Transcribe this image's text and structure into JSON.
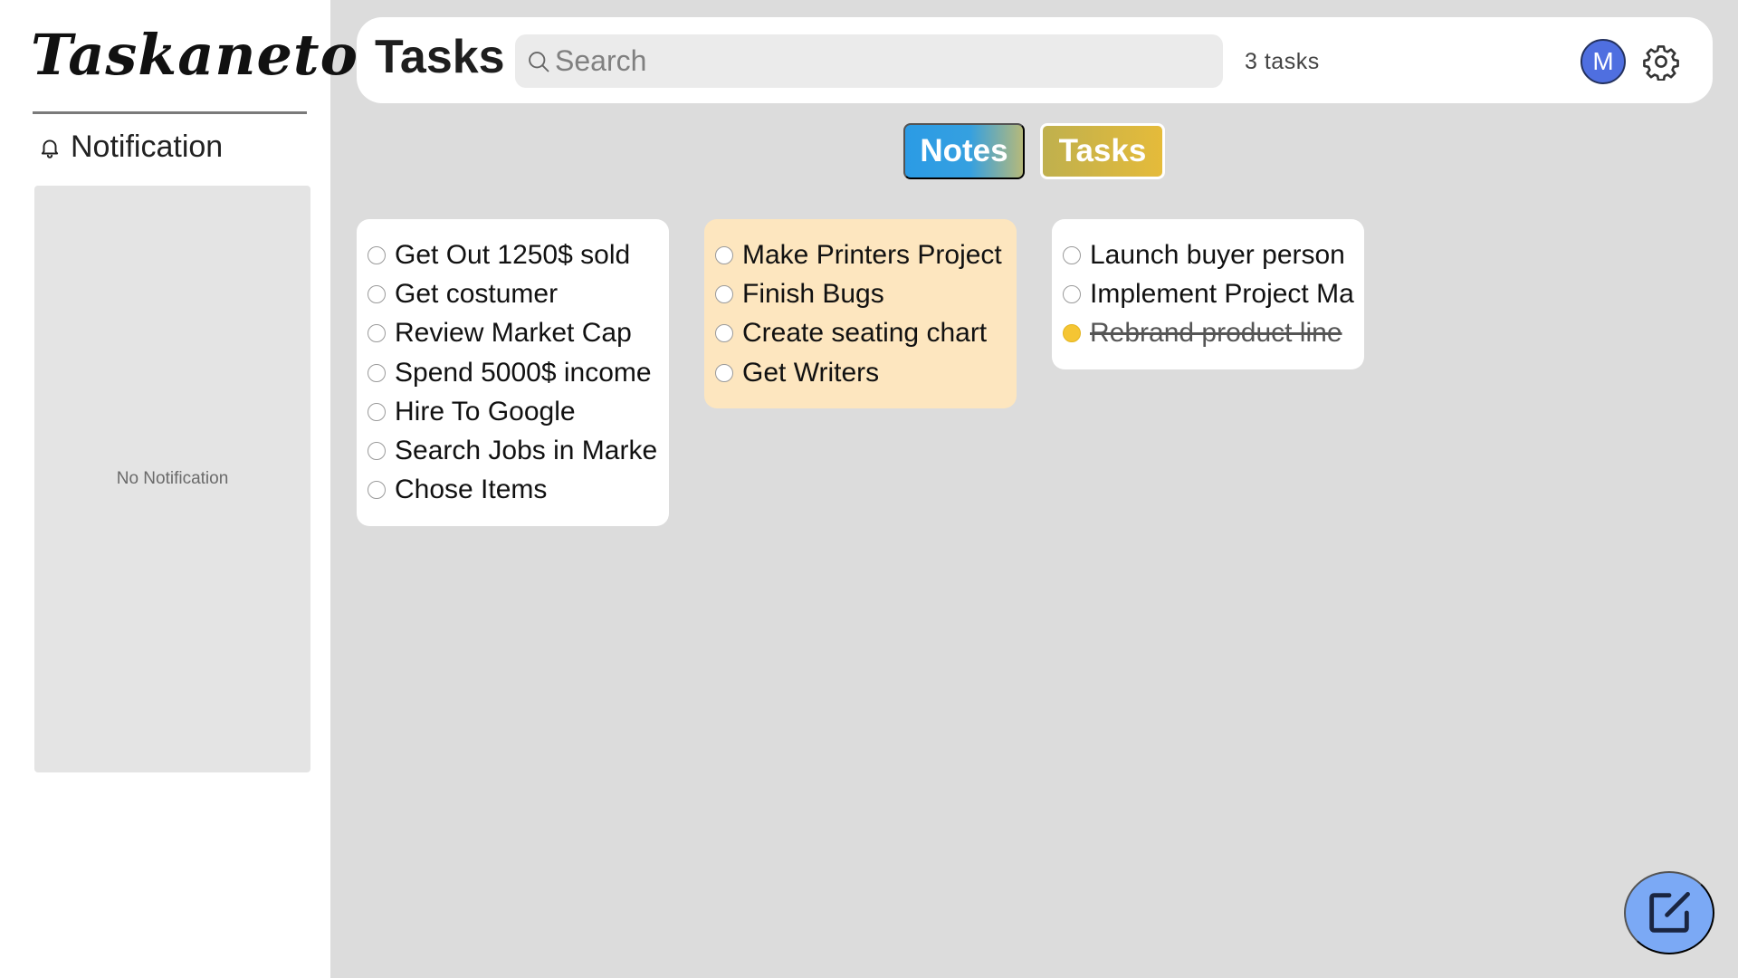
{
  "sidebar": {
    "logo": "Taskaneto",
    "notification_title": "Notification",
    "empty_text": "No Notification"
  },
  "header": {
    "title": "Tasks",
    "search_placeholder": "Search",
    "search_value": "",
    "task_count": "3 tasks",
    "avatar_initial": "M"
  },
  "toggle": {
    "notes_label": "Notes",
    "tasks_label": "Tasks",
    "active": "Tasks"
  },
  "cards": [
    {
      "color": "#ffffff",
      "tasks": [
        {
          "text": "Get Out 1250$ sold",
          "done": false
        },
        {
          "text": "Get costumer",
          "done": false
        },
        {
          "text": "Review Market Cap",
          "done": false
        },
        {
          "text": "Spend 5000$ income",
          "done": false
        },
        {
          "text": "Hire To Google",
          "done": false
        },
        {
          "text": "Search Jobs in Marke",
          "done": false
        },
        {
          "text": "Chose Items",
          "done": false
        }
      ]
    },
    {
      "color": "#fde6bf",
      "tasks": [
        {
          "text": "Make Printers Project",
          "done": false
        },
        {
          "text": "Finish Bugs",
          "done": false
        },
        {
          "text": "Create seating chart",
          "done": false
        },
        {
          "text": "Get Writers",
          "done": false
        }
      ]
    },
    {
      "color": "#ffffff",
      "tasks": [
        {
          "text": "Launch buyer person",
          "done": false
        },
        {
          "text": "Implement Project Ma",
          "done": false
        },
        {
          "text": "Rebrand product line",
          "done": true
        }
      ]
    }
  ],
  "icons": {
    "bell": "bell-icon",
    "search": "search-icon",
    "settings": "gear-icon",
    "new_note": "edit-icon"
  },
  "colors": {
    "accent_blue": "#7ba9f5",
    "avatar_bg": "#4f6fe0",
    "done_check": "#f5c533"
  }
}
